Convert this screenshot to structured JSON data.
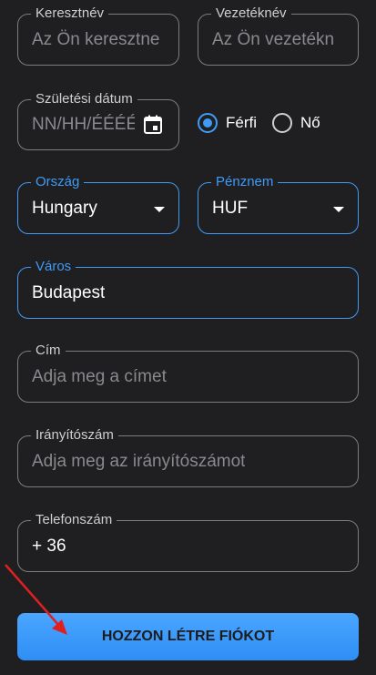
{
  "form": {
    "first_name": {
      "label": "Keresztnév",
      "placeholder": "Az Ön keresztne"
    },
    "last_name": {
      "label": "Vezetéknév",
      "placeholder": "Az Ön vezetékn"
    },
    "birth_date": {
      "label": "Születési dátum",
      "placeholder": "NN/HH/ÉÉÉÉ",
      "icon": "calendar-icon"
    },
    "gender": {
      "male_label": "Férfi",
      "female_label": "Nő",
      "selected": "Férfi"
    },
    "country": {
      "label": "Ország",
      "value": "Hungary"
    },
    "currency": {
      "label": "Pénznem",
      "value": "HUF"
    },
    "city": {
      "label": "Város",
      "value": "Budapest"
    },
    "address": {
      "label": "Cím",
      "placeholder": "Adja meg a címet"
    },
    "zip": {
      "label": "Irányítószám",
      "placeholder": "Adja meg az irányítószámot"
    },
    "phone": {
      "label": "Telefonszám",
      "value": "+ 36"
    },
    "submit_label": "HOZZON LÉTRE FIÓKOT"
  },
  "colors": {
    "accent": "#3f9bf5",
    "background": "#1f1f21",
    "border": "#7d7d80",
    "annotation_arrow": "#e02020"
  }
}
